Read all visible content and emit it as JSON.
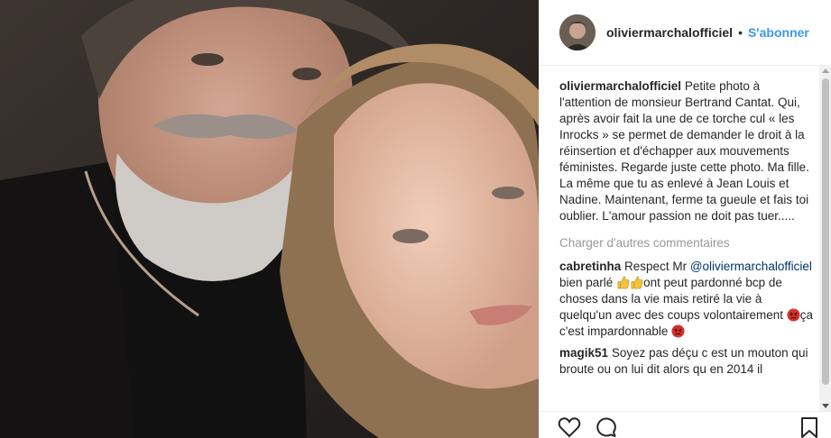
{
  "post": {
    "username": "oliviermarchalofficiel",
    "separator": "•",
    "follow_label": "S'abonner",
    "caption": "Petite photo à l'attention de monsieur Bertrand Cantat. Qui, après avoir fait la une de ce torche cul « les Inrocks » se permet de demander le droit à la réinsertion et d'échapper aux mouvements féministes. Regarde juste cette photo. Ma fille. La même que tu as enlevé à Jean Louis et Nadine. Maintenant, ferme ta gueule et fais toi oublier. L'amour passion ne doit pas tuer.....",
    "load_more": "Charger d'autres commentaires"
  },
  "comments": [
    {
      "user": "cabretinha",
      "text_a": "Respect Mr",
      "mention": "@oliviermarchalofficiel",
      "text_b": "bien parlé",
      "text_c": "ont peut pardonné bcp de choses dans la vie mais retiré la vie à quelqu'un avec des coups volontairement",
      "text_d": "ça c'est impardonnable"
    },
    {
      "user": "magik51",
      "text": "Soyez pas déçu c est un mouton qui broute ou on lui dit alors qu en 2014 il"
    }
  ],
  "icons": [
    "like-heart-icon",
    "comment-icon",
    "bookmark-icon",
    "thumbs-up-emoji",
    "angry-face-emoji"
  ],
  "colors": {
    "link": "#003569",
    "follow": "#3897f0",
    "muted": "#999999"
  }
}
